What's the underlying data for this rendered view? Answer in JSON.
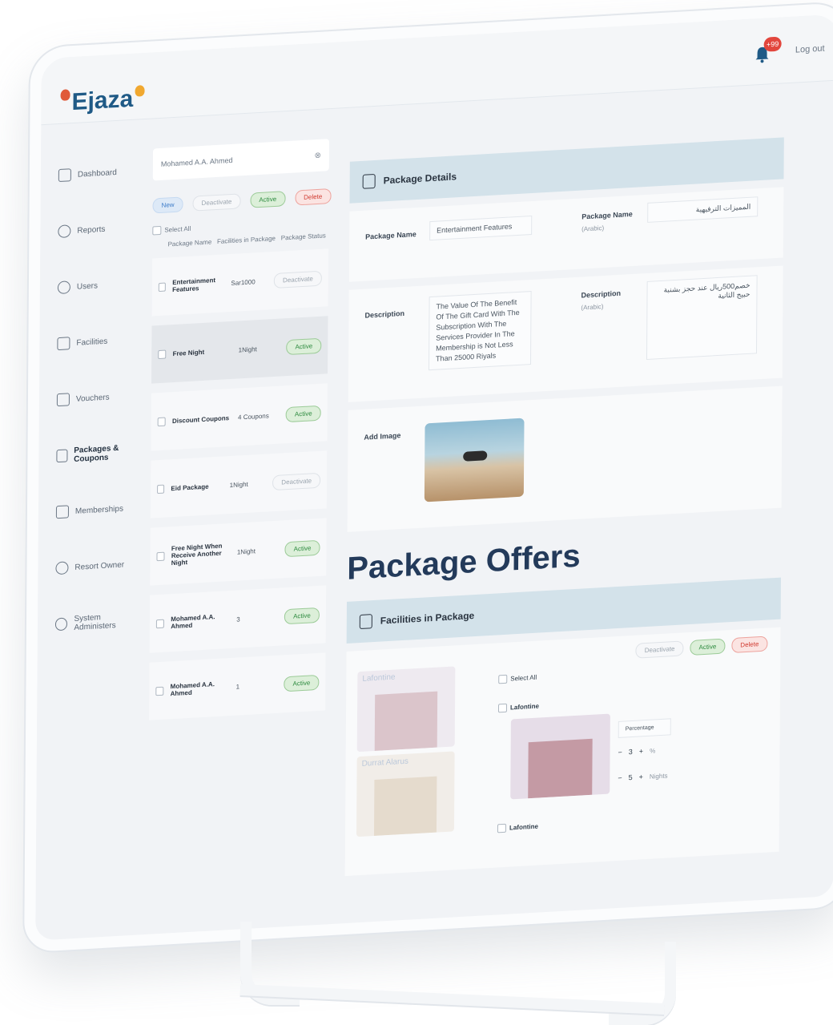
{
  "app": {
    "logo": "Ejaza",
    "notifications": "+99",
    "logout": "Log out"
  },
  "sidebar": {
    "items": [
      {
        "label": "Dashboard",
        "icon": "dashboard-icon",
        "active": false
      },
      {
        "label": "Reports",
        "icon": "reports-icon",
        "active": false
      },
      {
        "label": "Users",
        "icon": "users-icon",
        "active": false
      },
      {
        "label": "Facilities",
        "icon": "facilities-icon",
        "active": false
      },
      {
        "label": "Vouchers",
        "icon": "vouchers-icon",
        "active": false
      },
      {
        "label": "Packages & Coupons",
        "icon": "packages-icon",
        "active": true
      },
      {
        "label": "Memberships",
        "icon": "memberships-icon",
        "active": false
      },
      {
        "label": "Resort Owner",
        "icon": "resort-owner-icon",
        "active": false
      },
      {
        "label": "System Administers",
        "icon": "admins-icon",
        "active": false
      }
    ]
  },
  "list": {
    "search_value": "Mohamed A.A. Ahmed",
    "actions": {
      "new": "New",
      "deactivate": "Deactivate",
      "active": "Active",
      "delete": "Delete"
    },
    "select_all": "Select All",
    "columns": [
      "Package Name",
      "Facilities in Package",
      "Package Status"
    ],
    "rows": [
      {
        "name": "Entertainment Features",
        "value": "Sar1000",
        "status": "Deactivate",
        "selected": false
      },
      {
        "name": "Free Night",
        "value": "1Night",
        "status": "Active",
        "selected": true
      },
      {
        "name": "Discount Coupons",
        "value": "4 Coupons",
        "status": "Active",
        "selected": false
      },
      {
        "name": "Eid Package",
        "value": "1Night",
        "status": "Deactivate",
        "selected": false
      },
      {
        "name": "Free Night When Receive Another Night",
        "value": "1Night",
        "status": "Active",
        "selected": false
      },
      {
        "name": "Mohamed A.A. Ahmed",
        "value": "3",
        "status": "Active",
        "selected": false
      },
      {
        "name": "Mohamed A.A. Ahmed",
        "value": "1",
        "status": "Active",
        "selected": false
      }
    ]
  },
  "details": {
    "title": "Package Details",
    "package_name_label": "Package Name",
    "package_name_value": "Entertainment Features",
    "package_name_ar_label": "Package Name",
    "arabic_tag": "(Arabic)",
    "package_name_ar_value": "المميزات الترفيهية",
    "description_label": "Description",
    "description_value": "The Value Of The Benefit Of The Gift Card With The Subscription With The Services Provider In The Membership is Not Less Than 25000 Riyals",
    "description_ar_label": "Description",
    "description_ar_value": "خصم500ريال عند حجز بشنبة حبيج الثانية",
    "add_image_label": "Add Image"
  },
  "offers": {
    "title": "Package Offers",
    "facilities_title": "Facilities in Package",
    "actions": {
      "deactivate": "Deactivate",
      "active": "Active",
      "delete": "Delete"
    },
    "select_all": "Select All",
    "thumbs": [
      "Lafontine",
      "Durrat Alarus",
      "Lafontine"
    ],
    "facility_name": "Lafontine",
    "type_select": "Percentage",
    "qty1": "3",
    "unit1": "%",
    "qty2": "5",
    "unit2": "Nights",
    "facility_name_2": "Lafontine"
  }
}
